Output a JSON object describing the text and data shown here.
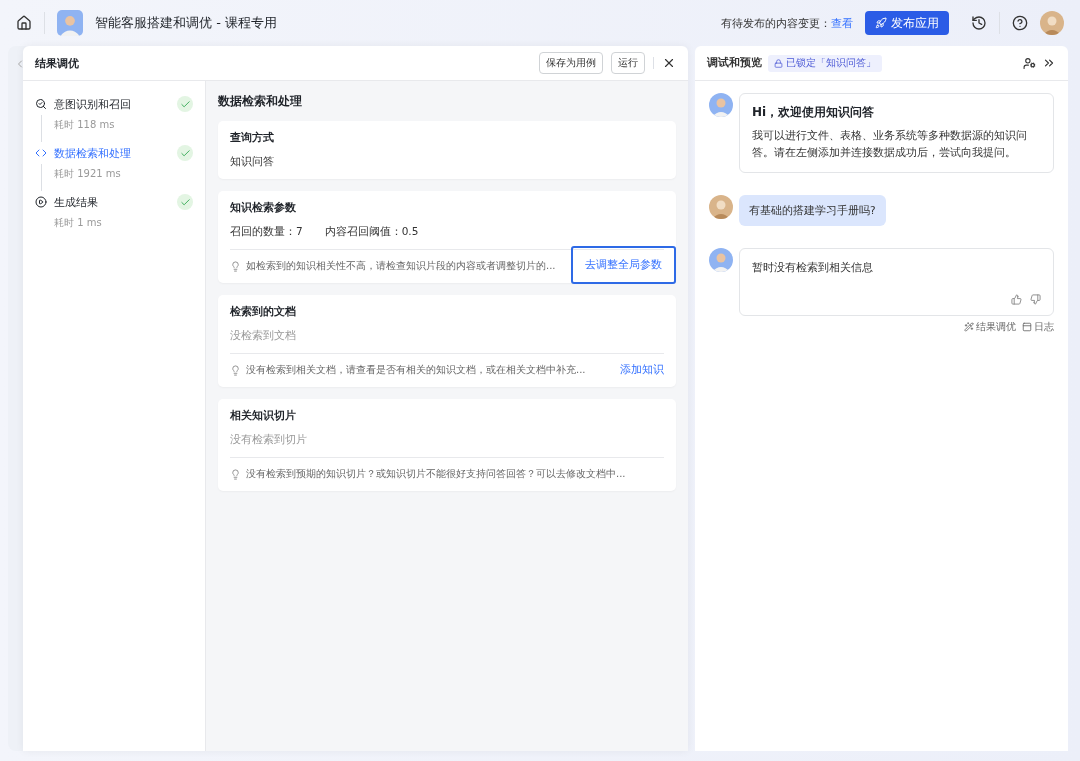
{
  "topbar": {
    "title": "智能客服搭建和调优 - 课程专用",
    "pending_label": "有待发布的内容变更：",
    "pending_link": "查看",
    "publish_button": "发布应用"
  },
  "modal": {
    "title": "结果调优",
    "buttons": [
      "保存为用例",
      "运行"
    ],
    "steps": [
      {
        "label": "意图识别和召回",
        "time": "耗时 118 ms",
        "selected": false,
        "done": true
      },
      {
        "label": "数据检索和处理",
        "time": "耗时 1921 ms",
        "selected": true,
        "done": true
      },
      {
        "label": "生成结果",
        "time": "耗时 1 ms",
        "selected": false,
        "done": true
      }
    ],
    "section_title": "数据检索和处理",
    "cards": [
      {
        "title": "查询方式",
        "value": "知识问答"
      },
      {
        "title": "知识检索参数",
        "params": [
          "召回的数量：7",
          "内容召回阈值：0.5"
        ],
        "tip": "如检索到的知识相关性不高，请检查知识片段的内容或者调整切片的...",
        "link": "去调整全局参数",
        "highlighted": true
      },
      {
        "title": "检索到的文档",
        "empty": "没检索到文档",
        "tip": "没有检索到相关文档，请查看是否有相关的知识文档，或在相关文档中补充...",
        "link": "添加知识",
        "highlighted": false
      },
      {
        "title": "相关知识切片",
        "empty": "没有检索到切片",
        "tip": "没有检索到预期的知识切片？或知识切片不能很好支持问答回答？可以去修改文档中..."
      }
    ]
  },
  "preview": {
    "title": "调试和预览",
    "lock_badge": "已锁定「知识问答」",
    "messages": [
      {
        "kind": "bot",
        "title": "Hi，欢迎使用知识问答",
        "text": "我可以进行文件、表格、业务系统等多种数据源的知识问答。请在左侧添加并连接数据成功后，尝试向我提问。"
      },
      {
        "kind": "user",
        "text": "有基础的搭建学习手册吗?"
      },
      {
        "kind": "bot",
        "text": "暂时没有检索到相关信息",
        "feedback": true,
        "actions": [
          "结果调优",
          "日志"
        ]
      }
    ]
  }
}
